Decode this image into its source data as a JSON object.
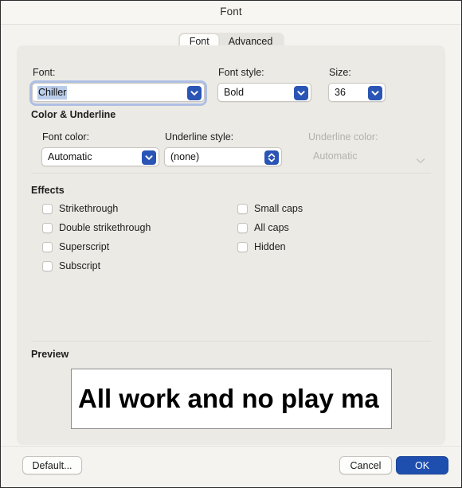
{
  "window": {
    "title": "Font"
  },
  "tabs": [
    {
      "label": "Font",
      "selected": true
    },
    {
      "label": "Advanced",
      "selected": false
    }
  ],
  "font_section": {
    "font_label": "Font:",
    "font_value": "Chiller",
    "font_style_label": "Font style:",
    "font_style_value": "Bold",
    "size_label": "Size:",
    "size_value": "36"
  },
  "color_underline": {
    "heading": "Color & Underline",
    "font_color_label": "Font color:",
    "font_color_value": "Automatic",
    "underline_style_label": "Underline style:",
    "underline_style_value": "(none)",
    "underline_color_label": "Underline color:",
    "underline_color_value": "Automatic"
  },
  "effects": {
    "heading": "Effects",
    "left_column": [
      {
        "label": "Strikethrough",
        "checked": false
      },
      {
        "label": "Double strikethrough",
        "checked": false
      },
      {
        "label": "Superscript",
        "checked": false
      },
      {
        "label": "Subscript",
        "checked": false
      }
    ],
    "right_column": [
      {
        "label": "Small caps",
        "checked": false
      },
      {
        "label": "All caps",
        "checked": false
      },
      {
        "label": "Hidden",
        "checked": false
      }
    ]
  },
  "preview": {
    "heading": "Preview",
    "text": "All work and no play ma"
  },
  "footer": {
    "default_label": "Default...",
    "cancel_label": "Cancel",
    "ok_label": "OK"
  },
  "colors": {
    "accent_blue": "#2a55b5",
    "primary_button": "#1f4fae",
    "selection_blue": "#b9cdea",
    "focus_ring": "#aebfe4",
    "panel_bg": "#eceae5",
    "window_bg": "#f4f3ef"
  }
}
